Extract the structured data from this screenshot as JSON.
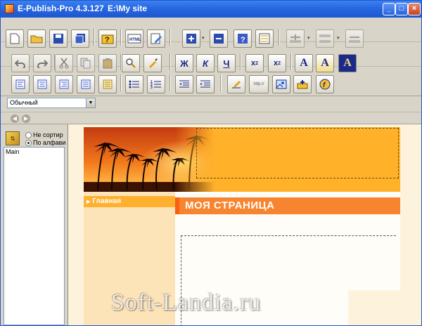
{
  "titlebar": {
    "app_title": "E-Publish-Pro 4.3.127",
    "path": "E:\\My site",
    "minimize": "_",
    "maximize": "□",
    "close": "×"
  },
  "toolbar": {
    "row2": {
      "bold": "Ж",
      "italic": "К",
      "underline": "Ч",
      "subscript": "x2",
      "superscript": "x2",
      "font_a1": "A",
      "font_a2": "A",
      "font_a3": "A"
    },
    "row3": {
      "link_label": "http://"
    }
  },
  "style_combo": {
    "value": "Обычный"
  },
  "left_panel": {
    "radio_1": "Не сортир",
    "radio_2": "По алфави",
    "tree_items": [
      "Main"
    ]
  },
  "page": {
    "nav_item": "Главная",
    "heading": "МОЯ СТРАНИЦА"
  },
  "watermark": "Soft-Landia.ru",
  "colors": {
    "banner": "#ffb12a",
    "heading_bar": "#f7842e",
    "sidebar": "#fde3b8",
    "titlebar": "#2767e0"
  }
}
